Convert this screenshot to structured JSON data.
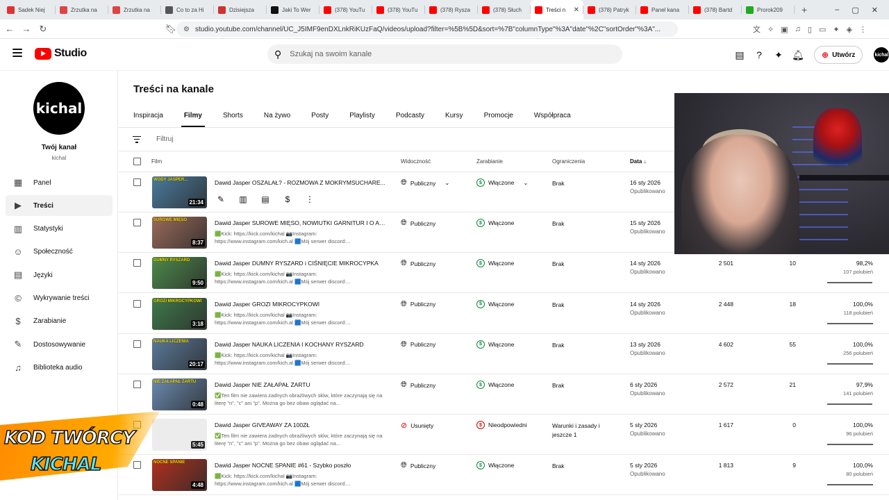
{
  "browser": {
    "tabs": [
      {
        "label": "Sadek Niej",
        "color": "#d33"
      },
      {
        "label": "Zrzutka na",
        "color": "#d44"
      },
      {
        "label": "Zrzutka na",
        "color": "#d44"
      },
      {
        "label": "Co to za Hi",
        "color": "#555"
      },
      {
        "label": "Dzisiejsza",
        "color": "#c33"
      },
      {
        "label": "Jaki To Wer",
        "color": "#111"
      },
      {
        "label": "(378) YouTu",
        "color": "#f00"
      },
      {
        "label": "(378) YouTu",
        "color": "#f00"
      },
      {
        "label": "(378) Rysza",
        "color": "#f00"
      },
      {
        "label": "(378) Słuch",
        "color": "#f00"
      },
      {
        "label": "Treści n",
        "color": "#f00",
        "active": true
      },
      {
        "label": "(378) Patryk",
        "color": "#f00"
      },
      {
        "label": "Panel kana",
        "color": "#f00"
      },
      {
        "label": "(378) Bartd",
        "color": "#f00"
      },
      {
        "label": "Prorok209",
        "color": "#2a2"
      }
    ],
    "url": "studio.youtube.com/channel/UC_J5IMF9enDXLnkRiKUzFaQ/videos/upload?filter=%5B%5D&sort=%7B\"columnType\"%3A\"date\"%2C\"sortOrder\"%3A\"..."
  },
  "header": {
    "logo_text": "Studio",
    "search_placeholder": "Szukaj na swoim kanale",
    "create_label": "Utwórz",
    "avatar_text": "kichal"
  },
  "sidebar": {
    "channel_title": "Twój kanał",
    "channel_handle": "kichal",
    "avatar_text": "kichal",
    "items": [
      {
        "label": "Panel",
        "icon": "dashboard-icon"
      },
      {
        "label": "Treści",
        "icon": "content-icon",
        "active": true
      },
      {
        "label": "Statystyki",
        "icon": "analytics-icon"
      },
      {
        "label": "Społeczność",
        "icon": "community-icon"
      },
      {
        "label": "Języki",
        "icon": "subtitles-icon"
      },
      {
        "label": "Wykrywanie treści",
        "icon": "copyright-icon"
      },
      {
        "label": "Zarabianie",
        "icon": "earn-icon"
      },
      {
        "label": "Dostosowywanie",
        "icon": "customize-icon"
      },
      {
        "label": "Biblioteka audio",
        "icon": "audio-library-icon"
      }
    ]
  },
  "main": {
    "title": "Treści na kanale",
    "tabs": [
      "Inspiracja",
      "Filmy",
      "Shorts",
      "Na żywo",
      "Posty",
      "Playlisty",
      "Podcasty",
      "Kursy",
      "Promocje",
      "Współpraca"
    ],
    "active_tab": "Filmy",
    "filter_placeholder": "Filtruj",
    "columns": {
      "film": "Film",
      "visibility": "Widoczność",
      "monetization": "Zarabianie",
      "restrictions": "Ograniczenia",
      "date": "Data"
    },
    "rows": [
      {
        "title": "Dawid Jasper OSZALAŁ? - ROZMOWA Z MOKRYMSUCHARE...",
        "desc": "",
        "duration": "21:34",
        "visibility": "Publiczny",
        "monetization": "Włączone",
        "restriction": "Brak",
        "date": "16 sty 2026",
        "status": "Opublikowano",
        "views": "",
        "comments": "",
        "likes_pct": "",
        "likes_count": "",
        "hover": true,
        "thumb": "#4a7b9d",
        "cap": "WODY JASPER..."
      },
      {
        "title": "Dawid Jasper SUROWE MIĘSO, NOWIUTKI GARNITUR I O AFE...",
        "desc": "🟩Kick: https://kick.com/kichal 📷Instagram: https://www.instagram.com/kich.al 🟦Mój serwer discord:...",
        "duration": "8:37",
        "visibility": "Publiczny",
        "monetization": "Włączone",
        "restriction": "Brak",
        "date": "15 sty 2026",
        "status": "Opublikowano",
        "views": "",
        "comments": "",
        "likes_pct": "",
        "likes_count": "",
        "thumb": "#9a6a5a",
        "cap": "SUROWE MIĘSO"
      },
      {
        "title": "Dawid Jasper DUMNY RYSZARD i CIŚNIĘCIE MIKROCYPKA",
        "desc": "🟩Kick: https://kick.com/kichal 📷Instagram: https://www.instagram.com/kich.al 🟦Mój serwer discord:...",
        "duration": "9:50",
        "visibility": "Publiczny",
        "monetization": "Włączone",
        "restriction": "Brak",
        "date": "14 sty 2026",
        "status": "Opublikowano",
        "views": "2 501",
        "comments": "10",
        "likes_pct": "98,2%",
        "likes_count": "107 polubień",
        "like_ratio": 0.982,
        "thumb": "#4c8a4a",
        "cap": "DUMNY RYSZARD"
      },
      {
        "title": "Dawid Jasper GROZI MIKROCYPKOWI",
        "desc": "🟩Kick: https://kick.com/kichal 📷Instagram: https://www.instagram.com/kich.al 🟦Mój serwer discord:...",
        "duration": "3:18",
        "visibility": "Publiczny",
        "monetization": "Włączone",
        "restriction": "Brak",
        "date": "14 sty 2026",
        "status": "Opublikowano",
        "views": "2 448",
        "comments": "18",
        "likes_pct": "100,0%",
        "likes_count": "118 polubień",
        "like_ratio": 1.0,
        "thumb": "#3f7a4b",
        "cap": "GROZI MIKROCYPKOWI"
      },
      {
        "title": "Dawid Jasper NAUKA LICZENIA I KOCHANY RYSZARD",
        "desc": "🟩Kick: https://kick.com/kichal 📷Instagram: https://www.instagram.com/kich.al 🟦Mój serwer discord:...",
        "duration": "20:17",
        "visibility": "Publiczny",
        "monetization": "Włączone",
        "restriction": "Brak",
        "date": "13 sty 2026",
        "status": "Opublikowano",
        "views": "4 602",
        "comments": "55",
        "likes_pct": "100,0%",
        "likes_count": "256 polubień",
        "like_ratio": 1.0,
        "thumb": "#5a7a9a",
        "cap": "NAUKA LICZENIA"
      },
      {
        "title": "Dawid Jasper NIE ZAŁAPAŁ ŻARTU",
        "desc": "✅Ten film nie zawiera żadnych obraźliwych słów, które zaczynają się na literę \"n\", \"c\" ani \"p\". Można go bez obaw oglądać na...",
        "duration": "0:48",
        "visibility": "Publiczny",
        "monetization": "Włączone",
        "restriction": "Brak",
        "date": "6 sty 2026",
        "status": "Opublikowano",
        "views": "2 572",
        "comments": "21",
        "likes_pct": "97,9%",
        "likes_count": "141 polubień",
        "like_ratio": 0.979,
        "thumb": "#6a8ab0",
        "cap": "NIE ZAŁAPAŁ ŻARTU"
      },
      {
        "title": "Dawid Jasper GIVEAWAY ZA 100ZŁ",
        "desc": "✅Ten film nie zawiera żadnych obraźliwych słów, które zaczynają się na literę \"n\", \"c\" ani \"p\". Można go bez obaw oglądać na...",
        "duration": "5:45",
        "visibility": "Usunięty",
        "monetization": "Nieodpowiedni",
        "restriction": "Warunki i zasady i jeszcze 1",
        "date": "5 sty 2026",
        "status": "Opublikowano",
        "views": "1 617",
        "comments": "0",
        "likes_pct": "100,0%",
        "likes_count": "96 polubień",
        "like_ratio": 1.0,
        "thumb": "#e8e8e8",
        "cap": "",
        "removed": true
      },
      {
        "title": "Dawid Jasper NOCNE SPANIE #61 - Szybko poszło",
        "desc": "🟩Kick: https://kick.com/kichal 📷Instagram: https://www.instagram.com/kich.al 🟦Mój serwer discord:...",
        "duration": "4:48",
        "visibility": "Publiczny",
        "monetization": "Włączone",
        "restriction": "Brak",
        "date": "5 sty 2026",
        "status": "Opublikowano",
        "views": "1 813",
        "comments": "9",
        "likes_pct": "100,0%",
        "likes_count": "80 polubień",
        "like_ratio": 1.0,
        "thumb": "#b0301e",
        "cap": "NOCNE SPANIE"
      }
    ]
  },
  "overlay": {
    "badge_line1": "KOD TWÓRCY",
    "badge_line2": "KICHAL"
  }
}
